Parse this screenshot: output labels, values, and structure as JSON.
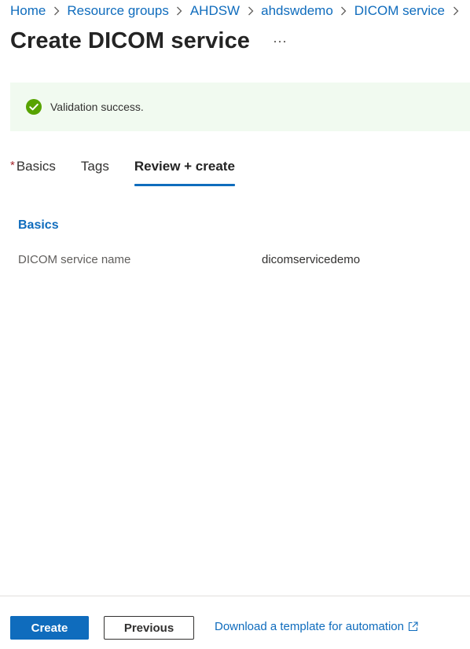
{
  "breadcrumb": {
    "items": [
      {
        "label": "Home"
      },
      {
        "label": "Resource groups"
      },
      {
        "label": "AHDSW"
      },
      {
        "label": "ahdswdemo"
      },
      {
        "label": "DICOM service"
      }
    ],
    "separator_icon": "chevron-right-icon"
  },
  "header": {
    "title": "Create DICOM service",
    "more_icon": "more-horizontal-icon"
  },
  "banner": {
    "text": "Validation success.",
    "icon": "success-checkmark-icon",
    "color": "#57a300",
    "background": "#f1faf0"
  },
  "tabs": {
    "items": [
      {
        "label": "Basics",
        "required_marker": "*"
      },
      {
        "label": "Tags"
      },
      {
        "label": "Review + create",
        "active": true
      }
    ],
    "accent": "#0f6cbd"
  },
  "summary": {
    "section_title": "Basics",
    "fields": [
      {
        "label": "DICOM service name",
        "value": "dicomservicedemo"
      }
    ]
  },
  "footer": {
    "create_label": "Create",
    "previous_label": "Previous",
    "download_label": "Download a template for automation",
    "download_icon": "external-link-icon"
  }
}
